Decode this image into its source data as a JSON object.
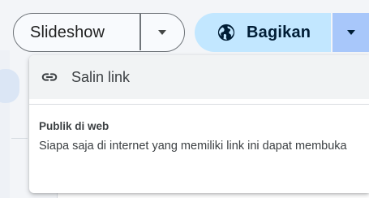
{
  "toolbar": {
    "slideshow_label": "Slideshow",
    "share_label": "Bagikan"
  },
  "menu": {
    "copy_link_label": "Salin link",
    "public_section_title": "Publik di web",
    "public_section_desc": "Siapa saja di internet yang memiliki link ini dapat membuka"
  },
  "colors": {
    "share_button": "#c2e7ff",
    "share_dropdown": "#a8c7fa",
    "menu_highlight": "#f1f3f4",
    "toolbar_bg": "#f3f5f8"
  },
  "icons": {
    "share": "globe-icon",
    "copy_link": "link-icon",
    "dropdown": "caret-down-icon"
  }
}
